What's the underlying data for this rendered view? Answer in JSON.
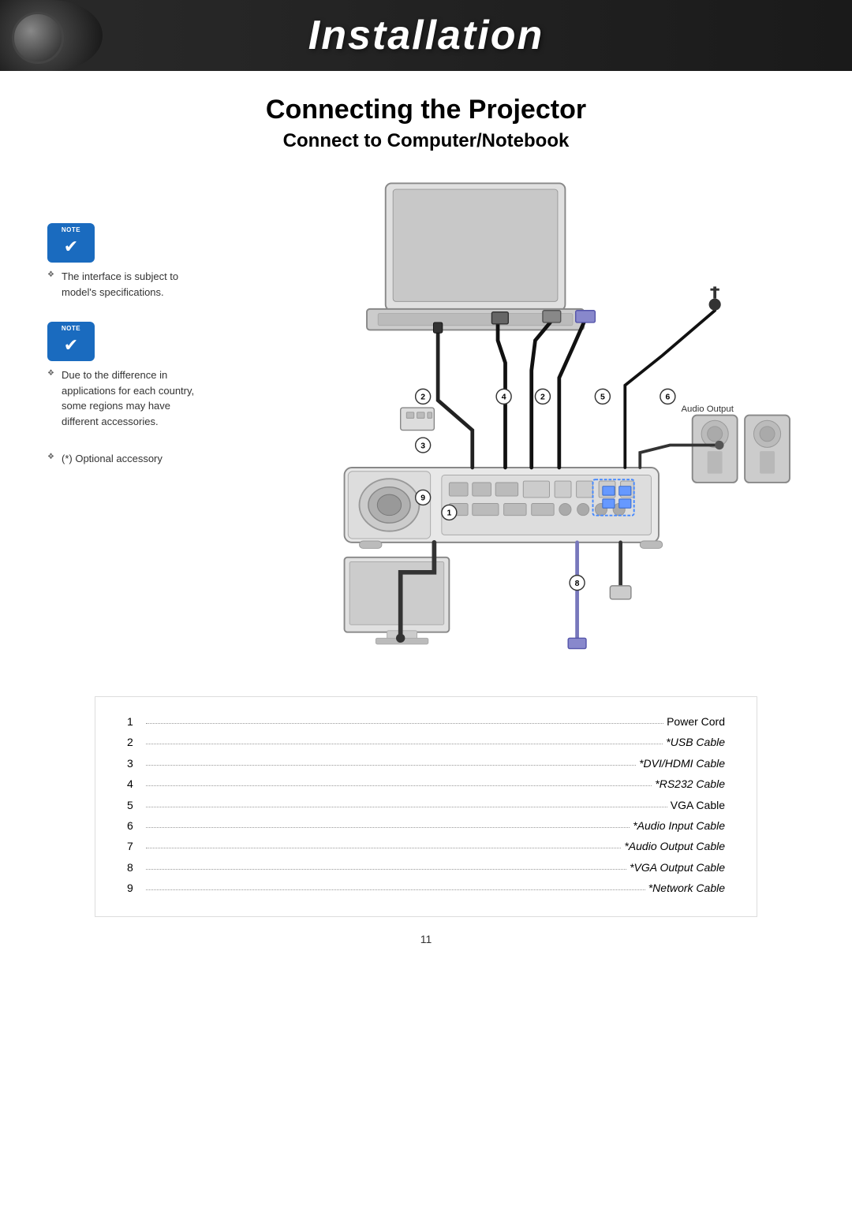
{
  "header": {
    "title": "Installation"
  },
  "main": {
    "section_title": "Connecting the Projector",
    "subsection_title": "Connect to Computer/Notebook",
    "audio_output_label": "Audio Output"
  },
  "notes": [
    {
      "id": "note1",
      "text": "The interface is subject to model's specifications."
    },
    {
      "id": "note2",
      "text": "Due to the difference in applications for each country, some regions may have different accessories."
    },
    {
      "id": "note3",
      "text": "(*) Optional accessory"
    }
  ],
  "cables": [
    {
      "num": "1",
      "name": "Power Cord",
      "optional": false
    },
    {
      "num": "2",
      "name": "*USB Cable",
      "optional": true
    },
    {
      "num": "3",
      "name": "*DVI/HDMI Cable",
      "optional": true
    },
    {
      "num": "4",
      "name": "*RS232 Cable",
      "optional": true
    },
    {
      "num": "5",
      "name": "VGA Cable",
      "optional": false
    },
    {
      "num": "6",
      "name": "*Audio Input Cable",
      "optional": true
    },
    {
      "num": "7",
      "name": "*Audio Output Cable",
      "optional": true
    },
    {
      "num": "8",
      "name": "*VGA Output Cable",
      "optional": true
    },
    {
      "num": "9",
      "name": "*Network Cable",
      "optional": true
    }
  ],
  "page_number": "11"
}
